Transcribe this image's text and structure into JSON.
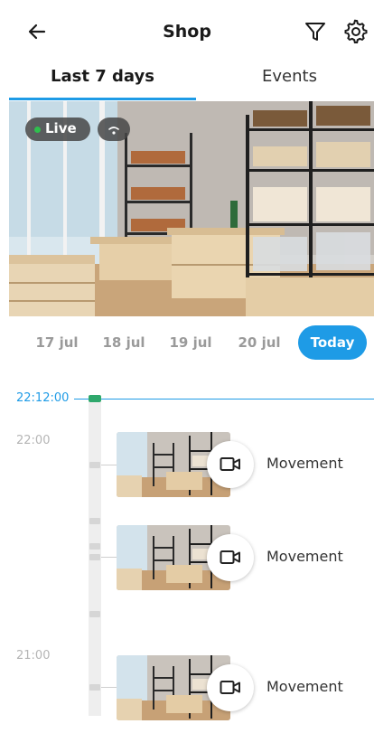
{
  "header": {
    "title": "Shop",
    "back_icon": "arrow-left-icon",
    "filter_icon": "filter-icon",
    "settings_icon": "gear-icon"
  },
  "tabs": [
    {
      "label": "Last 7 days",
      "active": true
    },
    {
      "label": "Events",
      "active": false
    }
  ],
  "camera": {
    "live_label": "Live",
    "status_icon": "wifi-icon"
  },
  "dates": [
    "17 jul",
    "18 jul",
    "19 jul",
    "20 jul",
    "Today"
  ],
  "selected_date": "Today",
  "timeline": {
    "current_time": "22:12:00",
    "hours": [
      "22:00",
      "21:00"
    ],
    "events": [
      {
        "label": "Movement",
        "icon": "video-camera-icon"
      },
      {
        "label": "Movement",
        "icon": "video-camera-icon"
      },
      {
        "label": "Movement",
        "icon": "video-camera-icon"
      }
    ]
  },
  "colors": {
    "accent": "#1e9be6",
    "live_dot": "#2fbf4e",
    "now_marker": "#2fa86c"
  }
}
